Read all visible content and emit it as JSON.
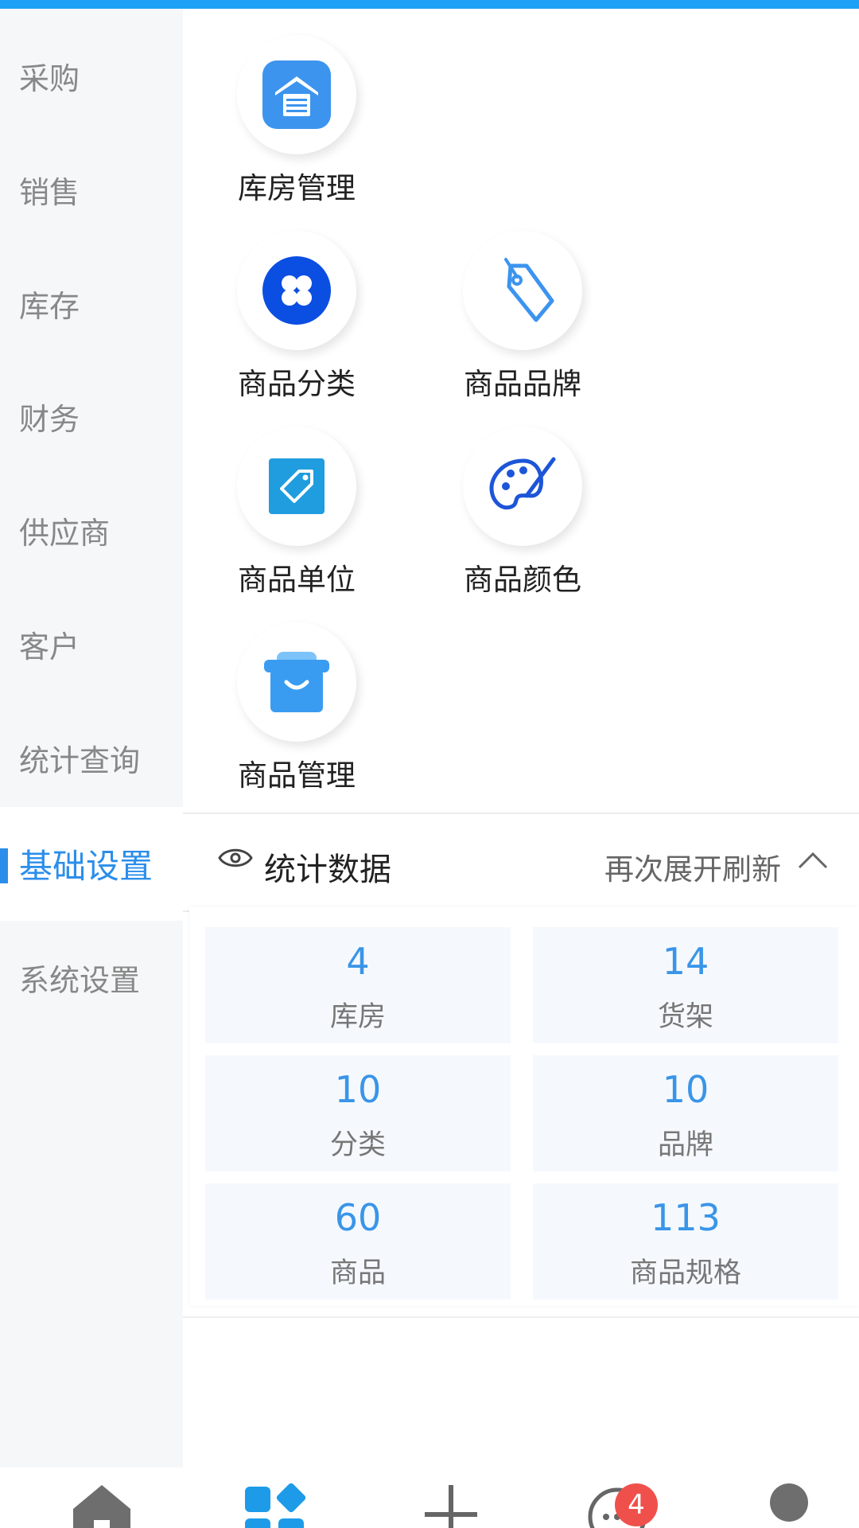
{
  "sidebar": {
    "items": [
      {
        "label": "采购"
      },
      {
        "label": "销售"
      },
      {
        "label": "库存"
      },
      {
        "label": "财务"
      },
      {
        "label": "供应商"
      },
      {
        "label": "客户"
      },
      {
        "label": "统计查询"
      },
      {
        "label": "基础设置",
        "active": true
      },
      {
        "label": "系统设置"
      }
    ]
  },
  "grid": {
    "tiles": [
      {
        "label": "库房管理",
        "icon": "warehouse-icon"
      },
      {
        "label": "商品分类",
        "icon": "category-icon"
      },
      {
        "label": "商品品牌",
        "icon": "tag-icon"
      },
      {
        "label": "商品单位",
        "icon": "unit-tag-icon"
      },
      {
        "label": "商品颜色",
        "icon": "palette-icon"
      },
      {
        "label": "商品管理",
        "icon": "shopping-bag-icon"
      }
    ]
  },
  "stats": {
    "title": "统计数据",
    "refresh_label": "再次展开刷新",
    "cards": [
      {
        "value": "4",
        "label": "库房"
      },
      {
        "value": "14",
        "label": "货架"
      },
      {
        "value": "10",
        "label": "分类"
      },
      {
        "value": "10",
        "label": "品牌"
      },
      {
        "value": "60",
        "label": "商品"
      },
      {
        "value": "113",
        "label": "商品规格"
      }
    ]
  },
  "tabbar": {
    "tabs": [
      {
        "icon": "home-icon"
      },
      {
        "icon": "apps-icon",
        "active": true
      },
      {
        "icon": "plus-icon"
      },
      {
        "icon": "message-icon"
      },
      {
        "icon": "user-icon"
      }
    ],
    "message_badge": "4"
  },
  "colors": {
    "accent": "#2b8eea",
    "topbar": "#1ea1f5",
    "badge": "#f0504b"
  }
}
